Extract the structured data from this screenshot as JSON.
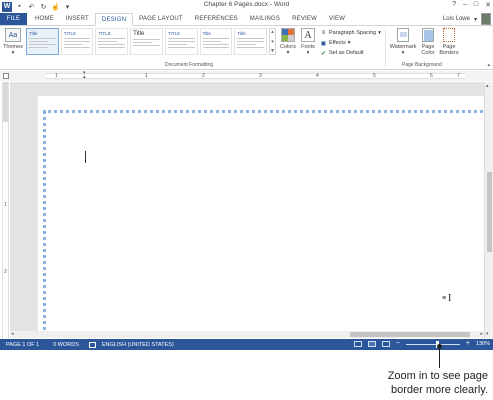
{
  "window": {
    "title": "Chapter 6 Pages.docx - Word",
    "controls": [
      "?",
      "–",
      "□",
      "✕"
    ]
  },
  "quick_access": {
    "logo_letter": "W",
    "buttons": [
      "save-icon",
      "undo-icon",
      "redo-icon",
      "touch-mode-icon"
    ]
  },
  "tabs": [
    {
      "label": "FILE"
    },
    {
      "label": "HOME"
    },
    {
      "label": "INSERT"
    },
    {
      "label": "DESIGN"
    },
    {
      "label": "PAGE LAYOUT"
    },
    {
      "label": "REFERENCES"
    },
    {
      "label": "MAILINGS"
    },
    {
      "label": "REVIEW"
    },
    {
      "label": "VIEW"
    }
  ],
  "active_tab": "DESIGN",
  "user": {
    "name": "Lois Lowe"
  },
  "ribbon": {
    "themes_label": "Themes",
    "themes_dropdown": "▾",
    "gallery_thumbs": [
      {
        "title": "Title",
        "style": "plain"
      },
      {
        "title": "TITLE",
        "style": "caps"
      },
      {
        "title": "TITLE",
        "style": "caps"
      },
      {
        "title": "Title",
        "style": "big"
      },
      {
        "title": "TITLE",
        "style": "caps"
      },
      {
        "title": "Title",
        "style": "plain"
      },
      {
        "title": "Title",
        "style": "plain"
      }
    ],
    "document_formatting_label": "Document Formatting",
    "colors_label": "Colors",
    "fonts_label": "Fonts",
    "fonts_glyph": "A",
    "paragraph_spacing_label": "Paragraph Spacing",
    "effects_label": "Effects",
    "set_default_label": "Set as Default",
    "watermark_label": "Watermark",
    "page_color_label": "Page\nColor",
    "page_borders_label": "Page\nBorders",
    "page_background_label": "Page Background"
  },
  "ruler": {
    "h_numbers": [
      "1",
      "1",
      "2",
      "3",
      "4",
      "5",
      "6",
      "7"
    ],
    "v_numbers": [
      "1",
      "2"
    ]
  },
  "colors": {
    "accent": "#2b579a",
    "page_border": "#8eb2e3",
    "workspace": "#e3e3e3"
  },
  "status": {
    "page": "PAGE 1 OF 1",
    "words": "0 WORDS",
    "language": "ENGLISH (UNITED STATES)",
    "zoom": "130%",
    "zoom_fraction": 0.57
  },
  "callout": {
    "text": "Zoom in to see page border more clearly."
  }
}
